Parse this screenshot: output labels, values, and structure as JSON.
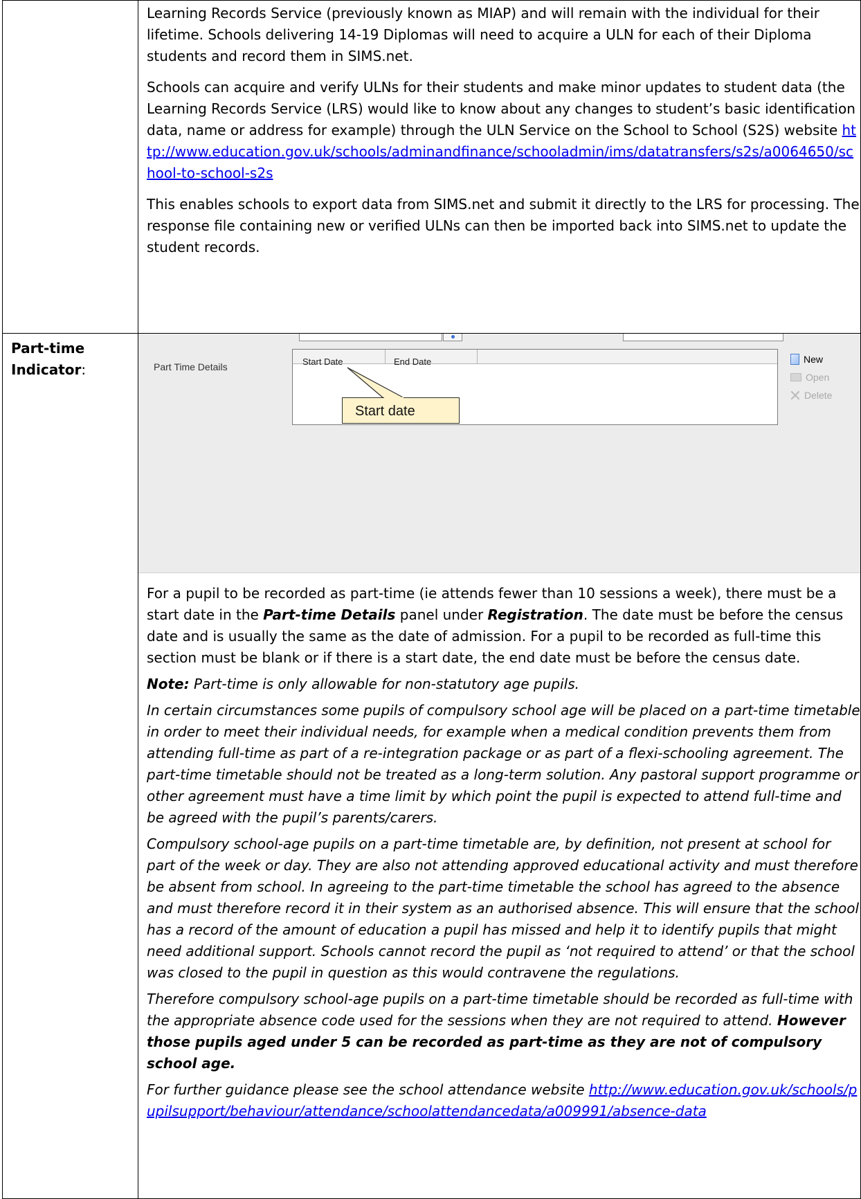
{
  "row1": {
    "label": "",
    "paragraphs": {
      "p1": "Learning Records Service (previously known as MIAP) and will remain with the individual for their lifetime.  Schools delivering 14-19 Diplomas will need to acquire a ULN for each of their Diploma students and record them in SIMS.net.",
      "p2_text": "Schools can acquire and verify ULNs for their students and make minor updates to student data (the Learning Records Service (LRS) would like to know about any changes to student’s basic identification data, name or address for example) through the ULN Service on the School to School (S2S) website ",
      "p2_link": "http://www.education.gov.uk/schools/adminandfinance/schooladmin/ims/datatransfers/s2s/a0064650/school-to-school-s2s",
      "p3": "This enables schools to export data from SIMS.net and submit it directly to the LRS for processing.  The response file containing new or verified ULNs can then be imported back into SIMS.net to update the student records."
    }
  },
  "row2": {
    "label_bold": "Part-time Indicator",
    "label_colon": ":",
    "screenshot": {
      "panel_label": "Part Time Details",
      "col_start": "Start Date",
      "col_end": "End Date",
      "callout": "Start date",
      "buttons": {
        "new": "New",
        "open": "Open",
        "delete": "Delete"
      },
      "icons": {
        "new": "new-document-icon",
        "open": "open-folder-icon",
        "delete": "delete-x-icon"
      }
    },
    "para1": {
      "a": "For a pupil to be recorded as part-time (ie attends fewer than 10 sessions a week), there must be a start date in the ",
      "b": "Part-time Details",
      "c": " panel under ",
      "d": "Registration",
      "e": ". The date must be before the census date and is usually the same as the date of admission.  For a pupil to be recorded as full-time this section must be blank or if there is a start date, the end date must be before the census date."
    },
    "note": {
      "label": "Note:",
      "text": "  Part-time is only allowable for non-statutory age pupils."
    },
    "italic_p1": "In certain circumstances some pupils of compulsory school age will be placed on a part-time timetable in order to meet their individual needs, for example when a medical condition prevents them from attending full-time as part of a re-integration package or as part of a flexi-schooling agreement.  The part-time timetable should not be treated as a long-term solution.  Any pastoral support programme or other agreement must have a time limit by which point the pupil is expected to attend full-time and be agreed with the pupil’s parents/carers.",
    "italic_p2": " Compulsory school-age pupils on a part-time timetable are, by definition, not present at school for part of the week or day.  They are also not attending approved educational activity and must therefore be absent from school.  In agreeing to the part-time timetable the school has agreed to the absence and must therefore record it in their system as an authorised absence. This will ensure that the school has a record of the amount of education a pupil has missed and help it to identify pupils that might need additional support.  Schools cannot record the pupil as ‘not required to attend’ or that the school was closed to the pupil in question as this would contravene the regulations.",
    "italic_p3": {
      "a": "Therefore compulsory school-age pupils on a part-time timetable should be recorded as full-time with the appropriate absence code used for the sessions when they are not required to attend. ",
      "b": "However those pupils aged under 5 can be recorded as part-time as they are not of compulsory school age."
    },
    "italic_p4": {
      "text": " For further guidance please see the school attendance website ",
      "link": "http://www.education.gov.uk/schools/pupilsupport/behaviour/attendance/schoolattendancedata/a009991/absence-data"
    }
  }
}
